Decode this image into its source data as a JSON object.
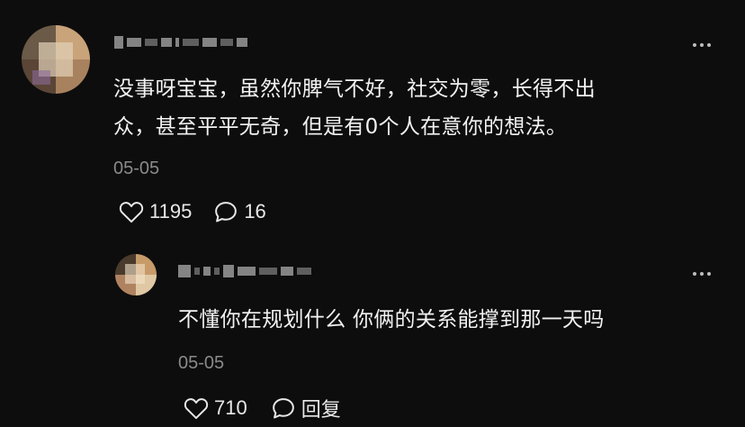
{
  "comments": [
    {
      "text_line1": "没事呀宝宝，虽然你脾气不好，社交为零，长得不出",
      "text_line2": "众，甚至平平无奇，但是有0个人在意你的想法。",
      "date": "05-05",
      "likes": "1195",
      "replies": "16",
      "like_icon": "heart-outline-icon",
      "reply_icon": "speech-bubble-icon",
      "more_icon": "more-dots-icon"
    },
    {
      "text": "不懂你在规划什么 你俩的关系能撑到那一天吗",
      "date": "05-05",
      "likes": "710",
      "reply_label": "回复",
      "like_icon": "heart-outline-icon",
      "reply_icon": "speech-bubble-icon",
      "more_icon": "more-dots-icon"
    }
  ],
  "colors": {
    "background": "#0d0d0d",
    "text": "#f2f2f2",
    "muted": "#8a8a8a"
  }
}
